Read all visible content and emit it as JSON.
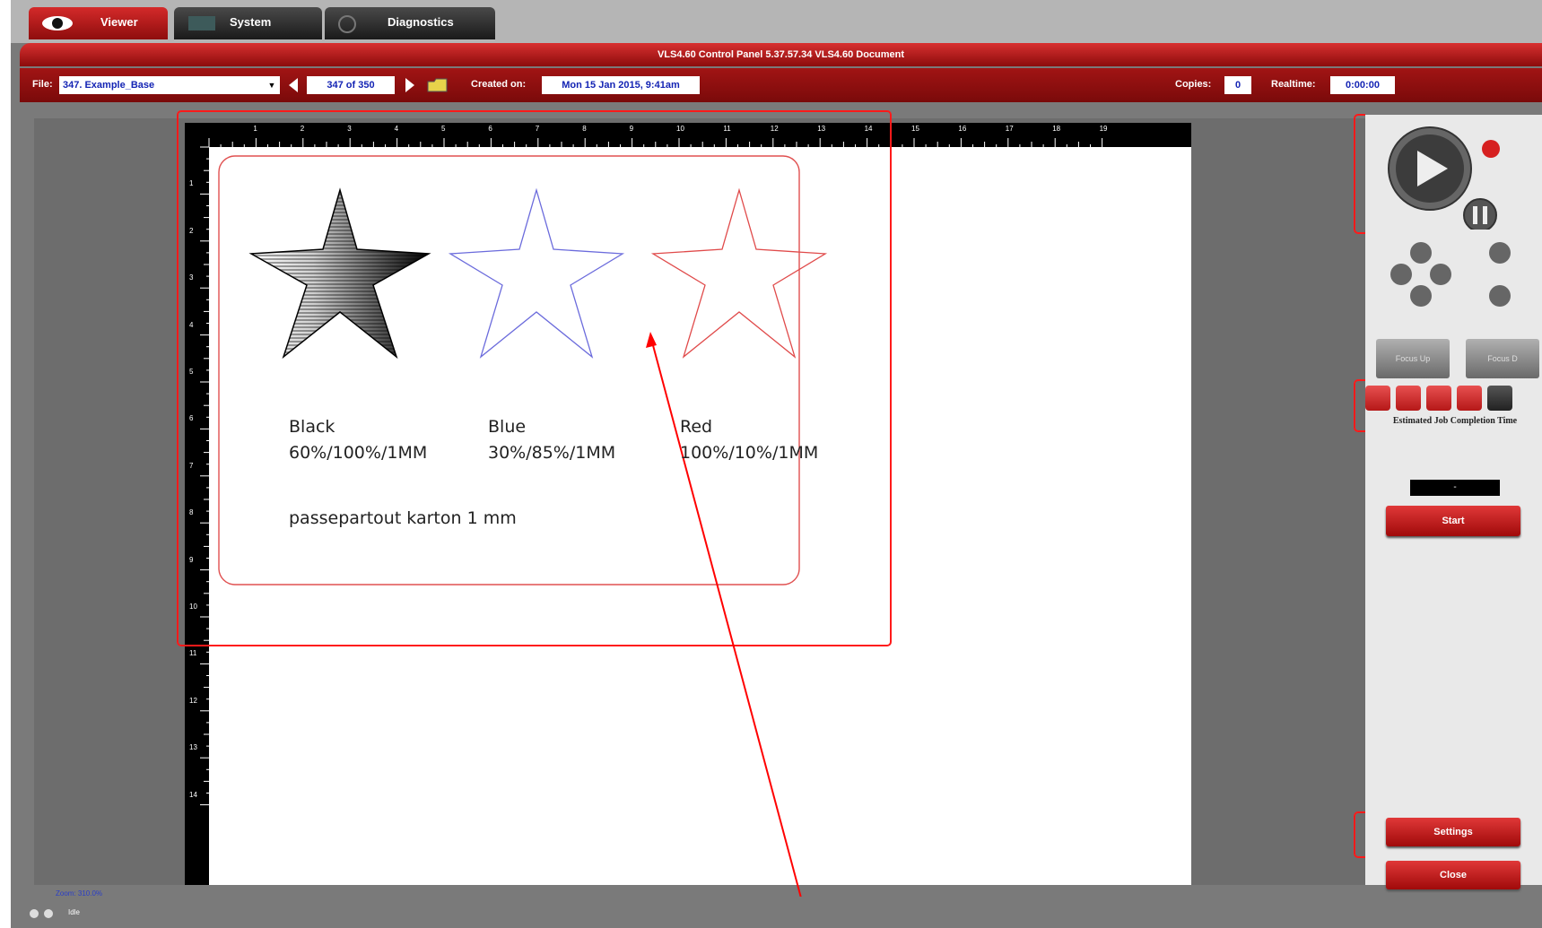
{
  "tabs": [
    {
      "label": "Viewer"
    },
    {
      "label": "System"
    },
    {
      "label": "Diagnostics"
    }
  ],
  "titlebar": {
    "text": "VLS4.60 Control Panel 5.37.57.34 VLS4.60 Document"
  },
  "filebar": {
    "file_label": "File:",
    "file_value": "347. Example_Base",
    "page_counter": "347 of 350",
    "created_label": "Created on:",
    "created_value": "Mon 15 Jan 2015, 9:41am",
    "copies_label": "Copies:",
    "copies_value": "0",
    "realtime_label": "Realtime:",
    "realtime_value": "0:00:00"
  },
  "ruler": {
    "top": [
      "1",
      "2",
      "3",
      "4",
      "5",
      "6",
      "7",
      "8",
      "9",
      "10",
      "11",
      "12",
      "13",
      "14",
      "15",
      "16",
      "17",
      "18",
      "19"
    ],
    "left": [
      "1",
      "2",
      "3",
      "4",
      "5",
      "6",
      "7",
      "8",
      "9",
      "10",
      "11",
      "12",
      "13",
      "14"
    ]
  },
  "document": {
    "labels": [
      {
        "name": "Black",
        "settings": "60%/100%/1MM"
      },
      {
        "name": "Blue",
        "settings": "30%/85%/1MM"
      },
      {
        "name": "Red",
        "settings": "100%/10%/1MM"
      }
    ],
    "note": "passepartout karton 1 mm",
    "colors": {
      "black": "#000000",
      "blue": "#6b6bdc",
      "red": "#e04a4a"
    }
  },
  "panel": {
    "focus_label": "Focus Up",
    "focus_down_label": "Focus D",
    "estimated_label": "Estimated Job Completion Time",
    "estimated_value": "-",
    "start_label": "Start",
    "settings_label": "Settings",
    "close_label": "Close"
  },
  "status": {
    "zoom": "Zoom: 310.0%",
    "idle": "Idle"
  },
  "colors": {
    "accent": "#c81e1e",
    "annotation": "#ff0000"
  }
}
